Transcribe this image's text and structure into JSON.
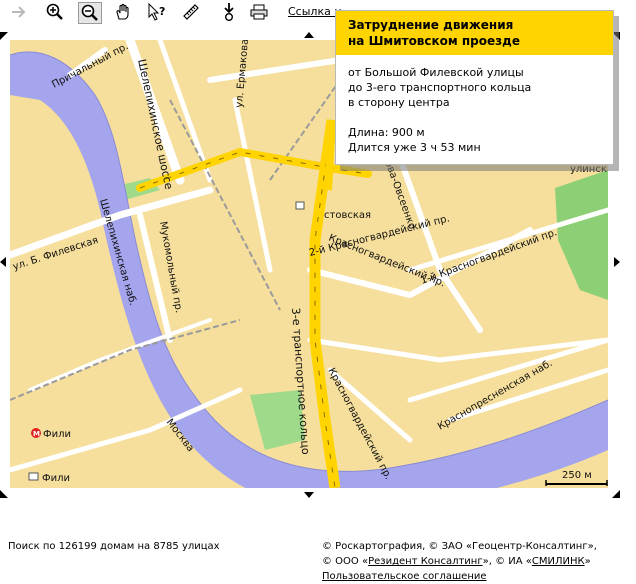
{
  "toolbar": {
    "buttons": [
      {
        "icon": "arrow-right-icon"
      },
      {
        "icon": "zoom-in-icon"
      },
      {
        "icon": "zoom-out-icon"
      },
      {
        "icon": "hand-pan-icon"
      },
      {
        "icon": "pointer-question-icon"
      },
      {
        "icon": "ruler-icon"
      },
      {
        "icon": "download-icon"
      },
      {
        "icon": "print-icon"
      }
    ],
    "link_label": "Ссылка н"
  },
  "popup": {
    "title_line1": "Затруднение движения",
    "title_line2": "на Шмитовском проезде",
    "line1": "от Большой Филевской улицы",
    "line2": "до 3-его транспортного кольца",
    "line3": "в сторону центра",
    "length": "Длина: 900 м",
    "duration": "Длится уже 3 ч 53 мин"
  },
  "map": {
    "labels": {
      "prichalny": "Причальный пр.",
      "shelepikhinskoe": "Шелепихинское шоссе",
      "ul_ermakova": "ул. Ермакова Роща",
      "mukomolny": "Мукомольный пр.",
      "shelepikhinskaya_nab": "Шелепихинская наб.",
      "b_filevskaya": "ул. Б. Филевская",
      "stovskaya": "стовская",
      "ovseenko": "нова-Овсеенко",
      "ulinsk": "улинск",
      "krasnogv_1": "1-й Красногвардейский пр.",
      "krasnogv_main": "Красногвардейский пр.",
      "krasnogv_2": "2-й Красногвардейский пр.",
      "ttk": "3-е транспортное кольцо",
      "krasnogv_bottom": "Красногвардейский пр.",
      "krasnopresn": "Краснопресненская наб.",
      "moskva": "Москва",
      "metro_fili": "Фили",
      "station_fili": "Фили",
      "scale": "250 м"
    },
    "colors": {
      "land": "#f6df9c",
      "water": "#a4a5ec",
      "road": "#ffffff",
      "jam": "#ffd400",
      "park": "#8ccf74",
      "metro": "#e22222"
    }
  },
  "status": "Поиск по 126199 домам на 8785 улицах",
  "footer": {
    "c1": "© Роскартография, © ЗАО «Геоцентр-Консалтинг»,",
    "c2_prefix": "© ООО «",
    "c2_link": "Резидент Консалтинг",
    "c2_mid": "», © ИА «",
    "c2_link2": "СМИЛИНК",
    "c2_suffix": "»",
    "agreement": "Пользовательское соглашение"
  }
}
